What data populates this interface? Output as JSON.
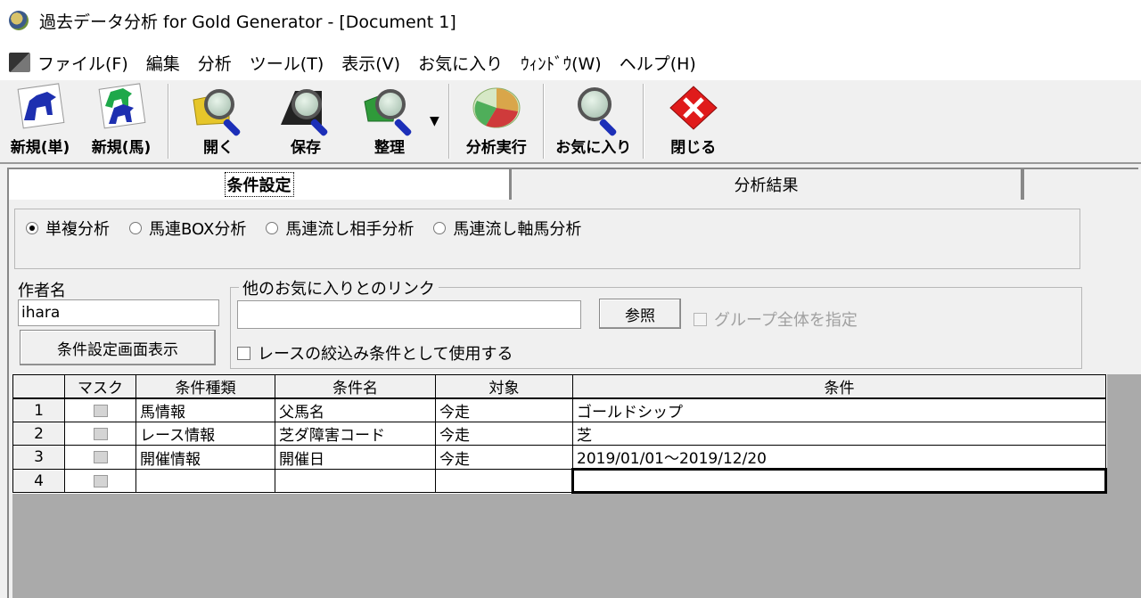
{
  "window": {
    "title": "過去データ分析 for Gold Generator - [Document 1]"
  },
  "menu": [
    {
      "label": "ファイル(F)"
    },
    {
      "label": "編集"
    },
    {
      "label": "分析"
    },
    {
      "label": "ツール(T)"
    },
    {
      "label": "表示(V)"
    },
    {
      "label": "お気に入り"
    },
    {
      "label": "ｳｨﾝﾄﾞｳ(W)"
    },
    {
      "label": "ヘルプ(H)"
    }
  ],
  "toolbar": {
    "new_single": "新規(単)",
    "new_horse": "新規(馬)",
    "open": "開く",
    "save": "保存",
    "organize": "整理",
    "run_analysis": "分析実行",
    "favorites": "お気に入り",
    "close": "閉じる"
  },
  "tabs": {
    "conditions": "条件設定",
    "results": "分析結果"
  },
  "analysis_types": [
    {
      "label": "単複分析",
      "checked": true
    },
    {
      "label": "馬連BOX分析",
      "checked": false
    },
    {
      "label": "馬連流し相手分析",
      "checked": false
    },
    {
      "label": "馬連流し軸馬分析",
      "checked": false
    }
  ],
  "author": {
    "label": "作者名",
    "value": "ihara",
    "show_button": "条件設定画面表示"
  },
  "link": {
    "legend": "他のお気に入りとのリンク",
    "value": "",
    "browse_button": "参照",
    "group_all": "グループ全体を指定",
    "use_as_race_filter": "レースの絞込み条件として使用する"
  },
  "grid": {
    "headers": [
      "",
      "マスク",
      "条件種類",
      "条件名",
      "対象",
      "条件"
    ],
    "rows": [
      {
        "num": "1",
        "type": "馬情報",
        "name": "父馬名",
        "target": "今走",
        "condition": "ゴールドシップ"
      },
      {
        "num": "2",
        "type": "レース情報",
        "name": "芝ダ障害コード",
        "target": "今走",
        "condition": "芝"
      },
      {
        "num": "3",
        "type": "開催情報",
        "name": "開催日",
        "target": "今走",
        "condition": "2019/01/01～2019/12/20"
      },
      {
        "num": "4",
        "type": "",
        "name": "",
        "target": "",
        "condition": ""
      }
    ]
  },
  "colors": {
    "toolbar_bg": "#f0f0f0",
    "grid_empty_bg": "#aaaaaa",
    "close_icon": "#e01b1b",
    "magnifier_handle": "#1c2fb8"
  }
}
